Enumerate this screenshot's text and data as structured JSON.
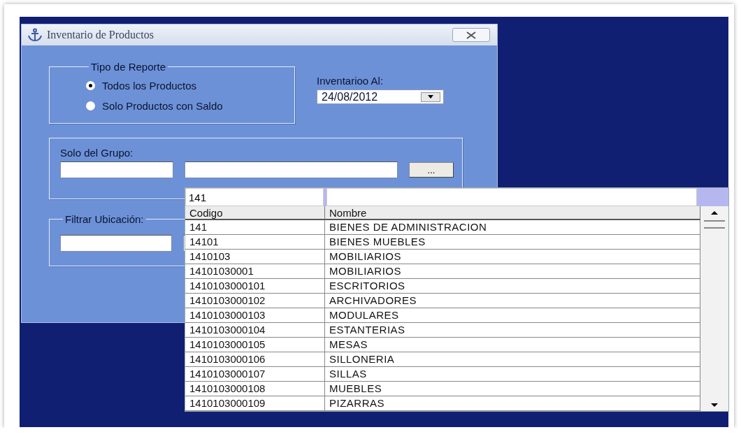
{
  "window": {
    "title": "Inventario de Productos"
  },
  "report_type": {
    "legend": "Tipo de Reporte",
    "options": [
      {
        "label": "Todos los Productos",
        "selected": true
      },
      {
        "label": "Solo Productos con Saldo",
        "selected": false
      }
    ]
  },
  "inventory_date": {
    "label": "Inventarioo Al:",
    "value": "24/08/2012"
  },
  "group_filter": {
    "label": "Solo del Grupo:",
    "browse_button": "..."
  },
  "location_filter": {
    "legend": "Filtrar Ubicación:"
  },
  "lookup": {
    "search_code": "141",
    "columns": [
      "Codigo",
      "Nombre"
    ],
    "rows": [
      {
        "code": "141",
        "name": "BIENES DE ADMINISTRACION"
      },
      {
        "code": "14101",
        "name": "BIENES MUEBLES"
      },
      {
        "code": "1410103",
        "name": "MOBILIARIOS"
      },
      {
        "code": "14101030001",
        "name": "MOBILIARIOS"
      },
      {
        "code": "1410103000101",
        "name": "ESCRITORIOS"
      },
      {
        "code": "1410103000102",
        "name": "ARCHIVADORES"
      },
      {
        "code": "1410103000103",
        "name": "MODULARES"
      },
      {
        "code": "1410103000104",
        "name": "ESTANTERIAS"
      },
      {
        "code": "1410103000105",
        "name": "MESAS"
      },
      {
        "code": "1410103000106",
        "name": "SILLONERIA"
      },
      {
        "code": "1410103000107",
        "name": "SILLAS"
      },
      {
        "code": "1410103000108",
        "name": "MUEBLES"
      },
      {
        "code": "1410103000109",
        "name": "PIZARRAS"
      }
    ]
  }
}
